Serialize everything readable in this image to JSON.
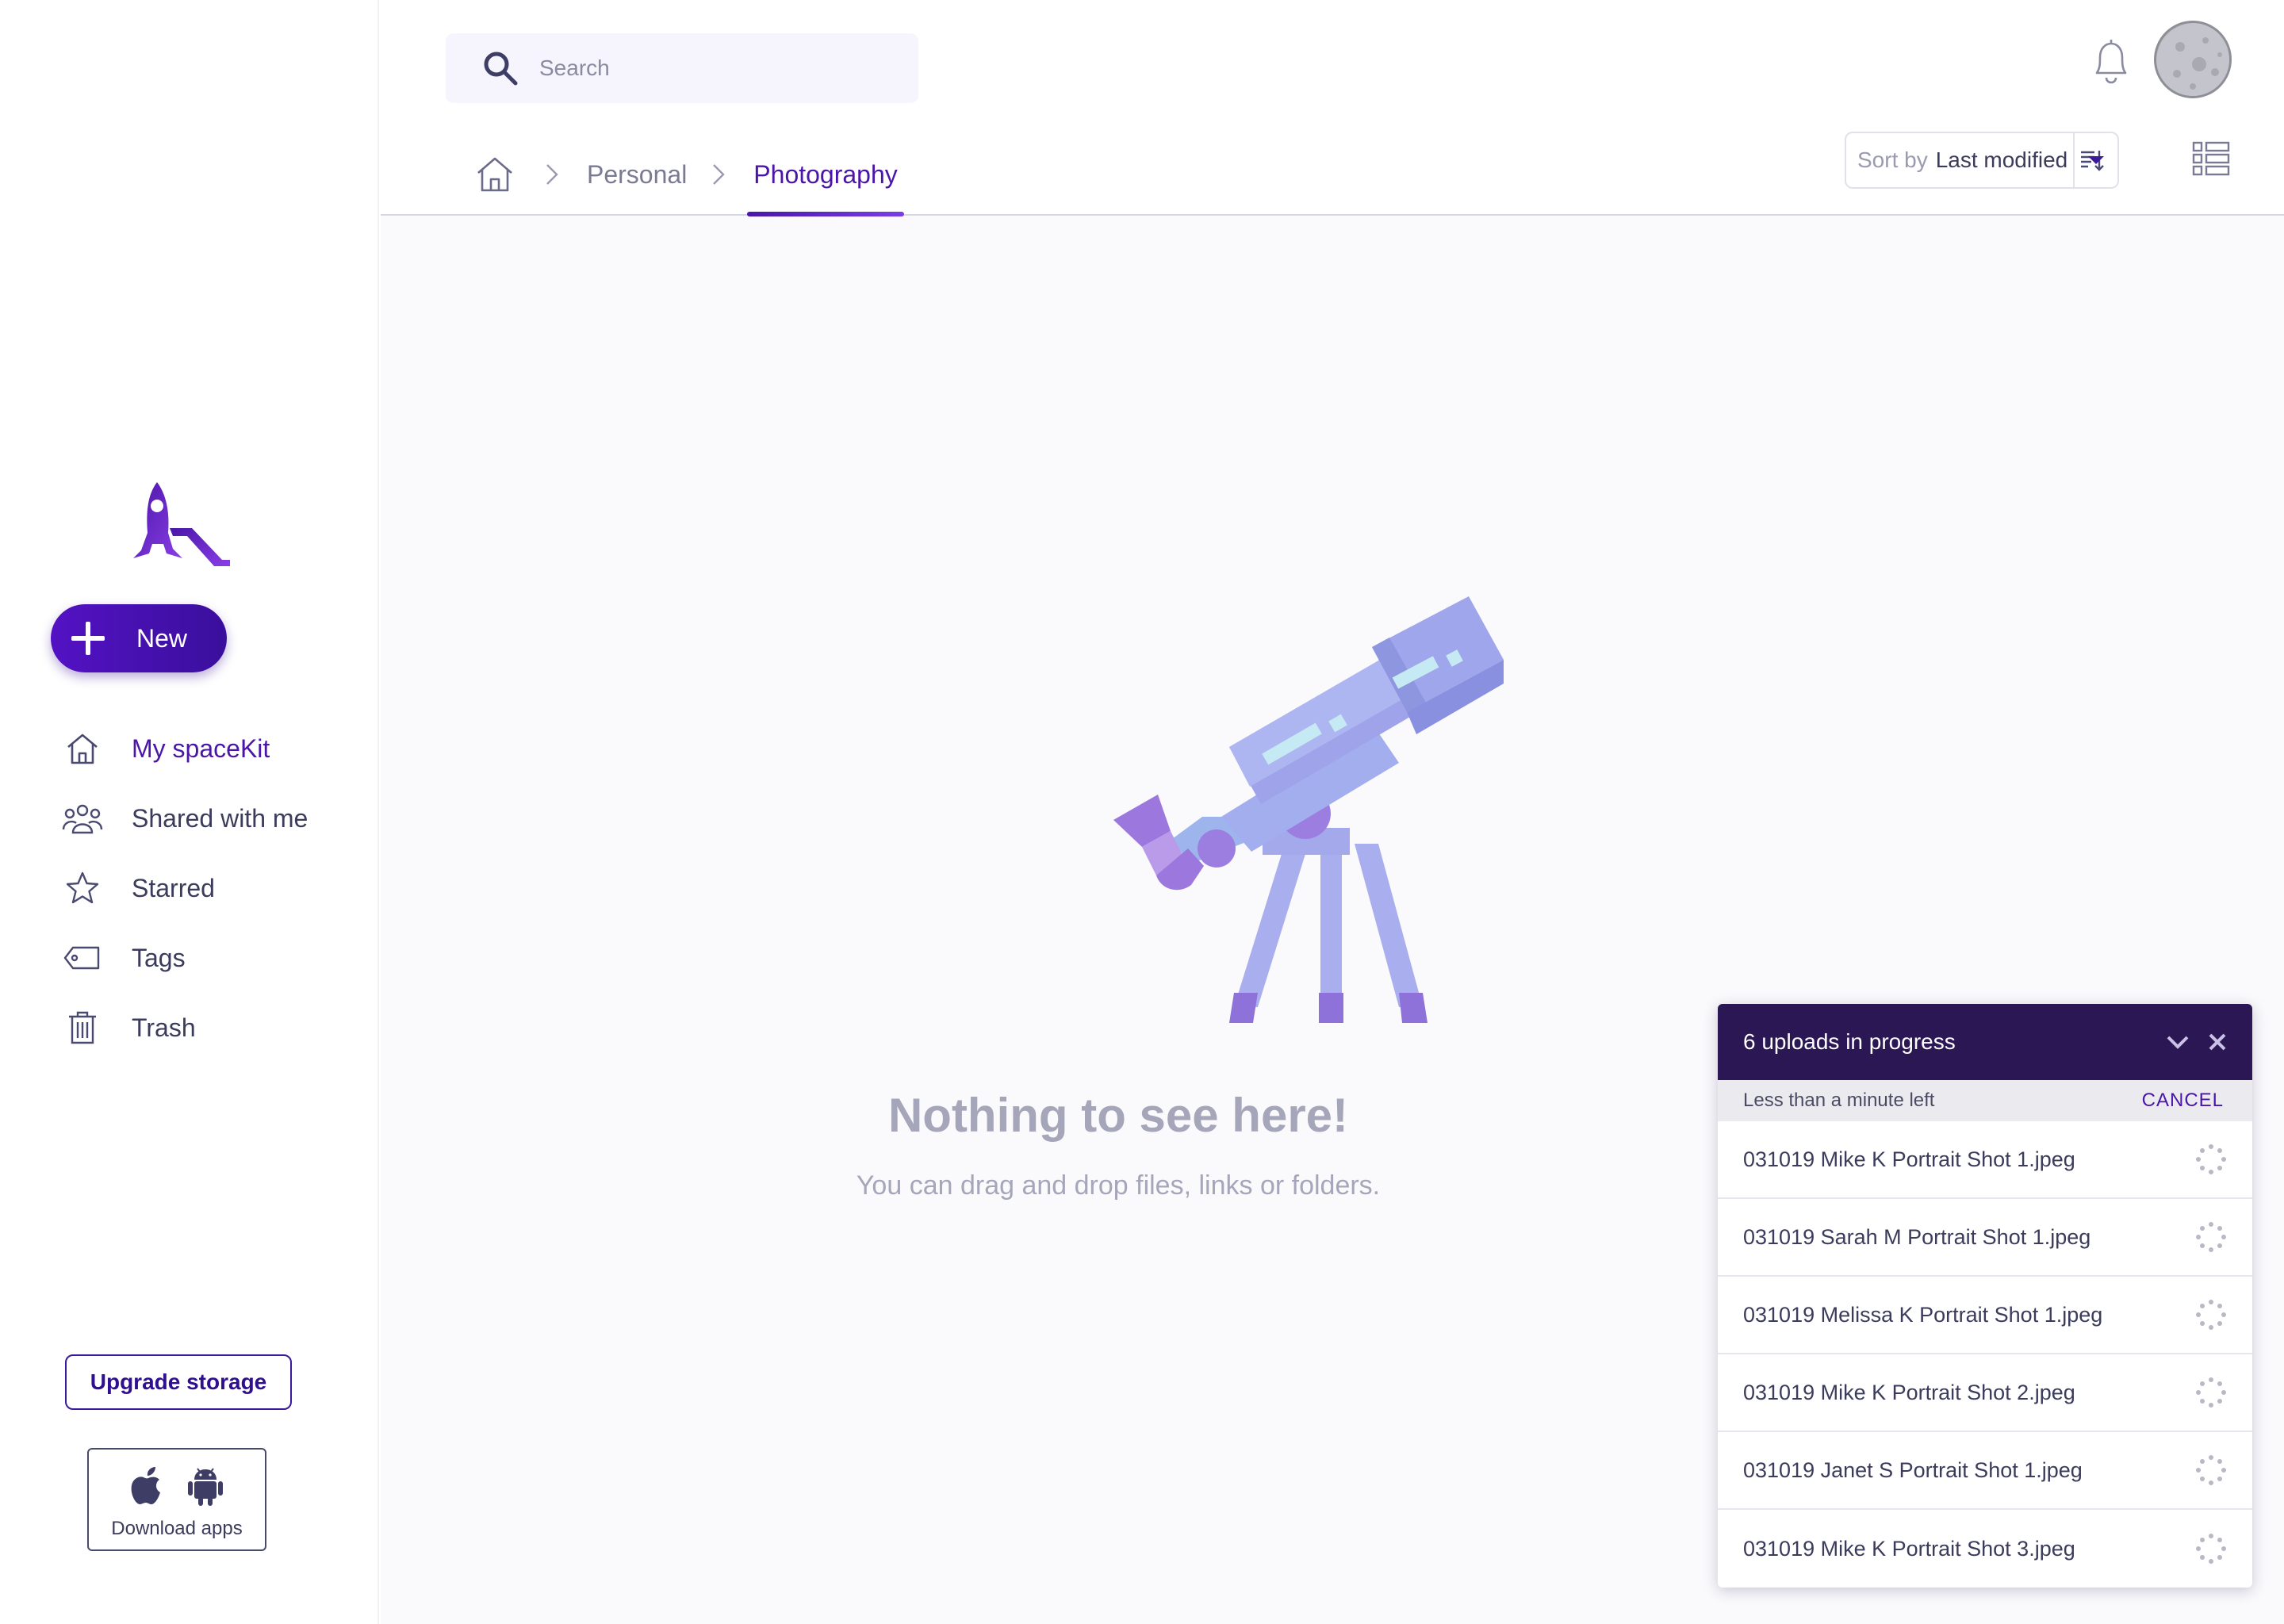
{
  "sidebar": {
    "new_label": "New",
    "nav": [
      {
        "label": "My spaceKit",
        "icon": "home-icon",
        "active": true
      },
      {
        "label": "Shared with me",
        "icon": "people-icon",
        "active": false
      },
      {
        "label": "Starred",
        "icon": "star-icon",
        "active": false
      },
      {
        "label": "Tags",
        "icon": "tag-icon",
        "active": false
      },
      {
        "label": "Trash",
        "icon": "trash-icon",
        "active": false
      }
    ],
    "upgrade_label": "Upgrade storage",
    "download_label": "Download apps"
  },
  "header": {
    "search_placeholder": "Search",
    "breadcrumb": [
      "Personal",
      "Photography"
    ],
    "sort_label": "Sort by",
    "sort_value": "Last modified"
  },
  "empty_state": {
    "title": "Nothing to see here!",
    "subtitle": "You can drag and drop files, links or folders."
  },
  "uploads": {
    "title": "6 uploads in progress",
    "time_left": "Less than a minute left",
    "cancel_label": "CANCEL",
    "files": [
      "031019 Mike K Portrait Shot 1.jpeg",
      "031019 Sarah M Portrait Shot 1.jpeg",
      "031019 Melissa K Portrait Shot 1.jpeg",
      "031019 Mike K Portrait Shot 2.jpeg",
      "031019 Janet S Portrait Shot 1.jpeg",
      "031019 Mike K Portrait Shot 3.jpeg"
    ]
  },
  "colors": {
    "brand": "#4a16a8",
    "upload_header": "#2a1754",
    "empty_text": "#a6a6ba"
  }
}
